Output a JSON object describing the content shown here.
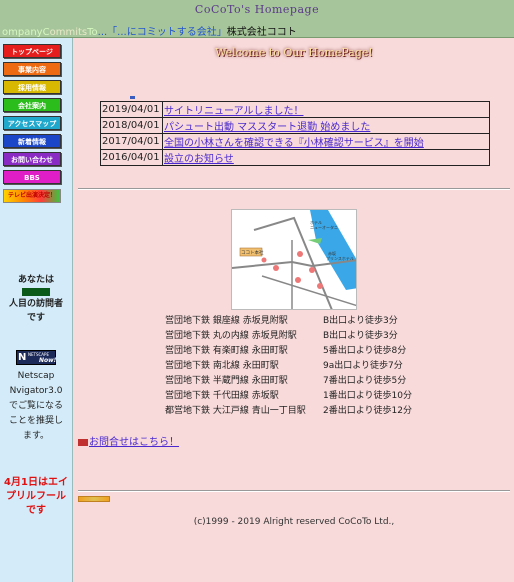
{
  "header": {
    "site_title": "CoCoTo's Homepage",
    "tagline": {
      "p1": "o",
      "p2": "mpany ",
      "p3": "C",
      "p4": "ommits ",
      "p5": "To",
      "p6": "...「...にコミットする会社」",
      "p7": "株式会社ココト"
    }
  },
  "sidebar": {
    "buttons": [
      {
        "label": "トップページ",
        "color": "#e61d1d"
      },
      {
        "label": "事業内容",
        "color": "#ee6a12"
      },
      {
        "label": "採用情報",
        "color": "#d8b800"
      },
      {
        "label": "会社案内",
        "color": "#2bbd1c"
      },
      {
        "label": "アクセスマップ",
        "color": "#1fa7cc"
      },
      {
        "label": "新着情報",
        "color": "#1c46c8"
      },
      {
        "label": "お問い合わせ",
        "color": "#8a2bc4"
      },
      {
        "label": "BBS",
        "color": "#e01ec8"
      }
    ],
    "banner_label": "テレビ出演決定！",
    "visitor": {
      "line1": "あなたは",
      "line2": "人目の訪問者",
      "line3": "です"
    },
    "netscape": {
      "badge_letter": "N",
      "badge_small": "NETSCAPE",
      "badge_now": "Now!",
      "lines": [
        "Netscap",
        "Nvigator3.0",
        "でご覧になる",
        "ことを推奨し",
        "ます。"
      ]
    },
    "april_fool": [
      "4月1日はエイ",
      "プリルフール",
      "です"
    ]
  },
  "main": {
    "welcome": "Welcome to Our HomePage!",
    "news": [
      {
        "date": "2019/04/01",
        "text": "サイトリニューアルしました！"
      },
      {
        "date": "2018/04/01",
        "text": "パシュート出動 マススタート退勤 始めました"
      },
      {
        "date": "2017/04/01",
        "text": "全国の小林さんを確認できる『小林確認サービス』を開始"
      },
      {
        "date": "2016/04/01",
        "text": "設立のお知らせ"
      }
    ],
    "access": [
      {
        "line": "営団地下鉄 銀座線 赤坂見附駅",
        "exit": "B出口より徒歩3分"
      },
      {
        "line": "営団地下鉄 丸の内線 赤坂見附駅",
        "exit": "B出口より徒歩3分"
      },
      {
        "line": "営団地下鉄 有楽町線 永田町駅",
        "exit": "5番出口より徒歩8分"
      },
      {
        "line": "営団地下鉄 南北線 永田町駅",
        "exit": "9a出口より徒歩7分"
      },
      {
        "line": "営団地下鉄 半蔵門線 永田町駅",
        "exit": "7番出口より徒歩5分"
      },
      {
        "line": "営団地下鉄 千代田線 赤坂駅",
        "exit": "1番出口より徒歩10分"
      },
      {
        "line": "都営地下鉄 大江戸線 青山一丁目駅",
        "exit": "2番出口より徒歩12分"
      }
    ],
    "contact_link": "お問合せはこちら！",
    "copyright": "(c)1999 - 2019 Alright reserved CoCoTo Ltd.,"
  },
  "map": {
    "labels": [
      "ホテル",
      "ニューオータニ",
      "赤坂",
      "プリンスホテル",
      "ココト本社"
    ]
  },
  "colors": {
    "header_bg": "#a7c59a",
    "sidebar_bg": "#d4ecf9",
    "page_bg": "#f8dada",
    "link": "#4a2ad0",
    "alert": "#e01010"
  }
}
